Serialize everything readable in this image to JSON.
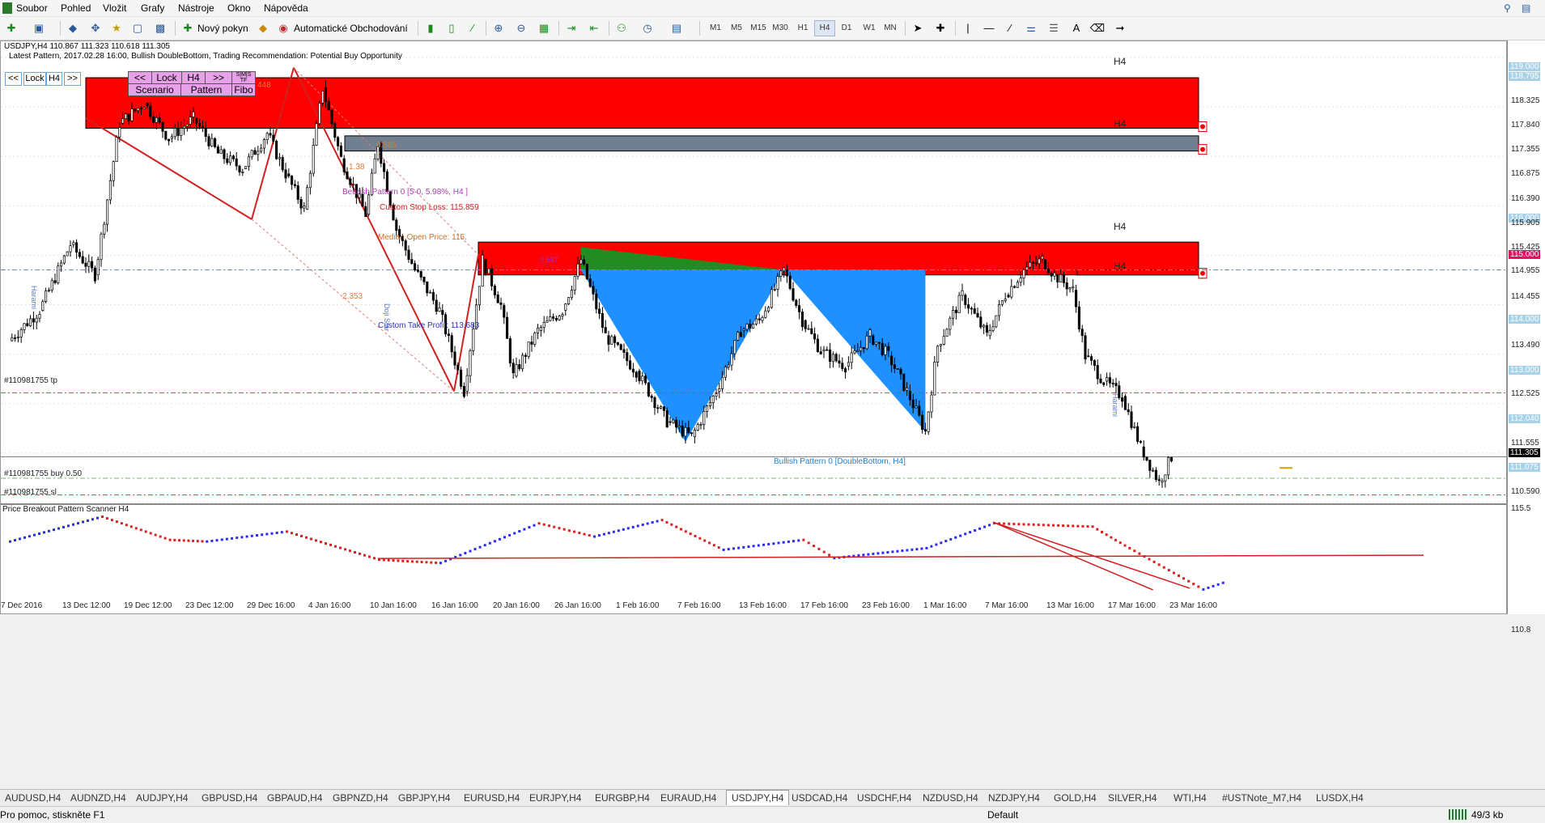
{
  "menu": [
    "Soubor",
    "Pohled",
    "Vložit",
    "Grafy",
    "Nástroje",
    "Okno",
    "Nápověda"
  ],
  "toolbar": {
    "new_order": "Nový pokyn",
    "algo_trading": "Automatické Obchodování",
    "timeframes": [
      "M1",
      "M5",
      "M15",
      "M30",
      "H1",
      "H4",
      "D1",
      "W1",
      "MN"
    ],
    "active_timeframe": "H4"
  },
  "chart": {
    "header": "USDJPY,H4  110.867 111.323 110.618 111.305",
    "subheader": "Latest Pattern, 2017.02.28 16:00, Bullish DoubleBottom, Trading Recommendation: Potential Buy Opportunity",
    "lock_widget": {
      "prev": "<<",
      "lock": "Lock",
      "tf": "H4",
      "next": ">>"
    },
    "panel": {
      "prev": "<<",
      "lock": "Lock",
      "tf": "H4",
      "next": ">>",
      "scenario": "Scenario",
      "pattern": "Pattern",
      "fibo": "Fibo",
      "smt": "S|M|S TF"
    },
    "zone_labels": [
      "H4",
      "H4",
      "H4",
      "H4"
    ],
    "fib_labels": [
      "0.585",
      "1.38",
      "2.353",
      "448"
    ],
    "bearish_pattern": "Bearish Pattern 0  [5-0,  5.98%, H4 ]",
    "custom_stop_loss": "Custom Stop Loss: 115.859",
    "median_open": "Median Open Price: 115.",
    "custom_take_profit": "Custom Take Profit: 113.683",
    "bullish_pattern": "Bullish Pattern 0  [DoubleBottom, H4]",
    "small_label": "0.597",
    "vertical_labels": {
      "harami_left": "Harami",
      "doji": "Doji Star",
      "harami_right": "Harami"
    },
    "orders": {
      "tp": "#110981755 tp",
      "buy": "#110981755 buy 0.50",
      "sl": "#110981755 sl"
    }
  },
  "price_axis": {
    "labels": [
      "119.000",
      "118.795",
      "118.325",
      "117.840",
      "117.355",
      "116.875",
      "116.390",
      "116.000",
      "115.905",
      "115.425",
      "115.000",
      "114.955",
      "114.455",
      "114.000",
      "113.490",
      "113.000",
      "112.525",
      "112.040",
      "111.555",
      "111.305",
      "111.075",
      "110.590"
    ],
    "current": "111.305",
    "level_115": "115.000"
  },
  "sub_window": {
    "title": "Price Breakout Pattern Scanner H4",
    "top_label": "115.5",
    "bottom_label": "110.8"
  },
  "time_axis": [
    "7 Dec 2016",
    "13 Dec 12:00",
    "19 Dec 12:00",
    "23 Dec 12:00",
    "29 Dec 16:00",
    "4 Jan 16:00",
    "10 Jan 16:00",
    "16 Jan 16:00",
    "20 Jan 16:00",
    "26 Jan 16:00",
    "1 Feb 16:00",
    "7 Feb 16:00",
    "13 Feb 16:00",
    "17 Feb 16:00",
    "23 Feb 16:00",
    "1 Mar 16:00",
    "7 Mar 16:00",
    "13 Mar 16:00",
    "17 Mar 16:00",
    "23 Mar 16:00"
  ],
  "tabs": [
    "AUDUSD,H4",
    "AUDNZD,H4",
    "AUDJPY,H4",
    "GBPUSD,H4",
    "GBPAUD,H4",
    "GBPNZD,H4",
    "GBPJPY,H4",
    "EURUSD,H4",
    "EURJPY,H4",
    "EURGBP,H4",
    "EURAUD,H4",
    "USDJPY,H4",
    "USDCAD,H4",
    "USDCHF,H4",
    "NZDUSD,H4",
    "NZDJPY,H4",
    "GOLD,H4",
    "SILVER,H4",
    "WTI,H4",
    "#USTNote_M7,H4",
    "LUSDX,H4"
  ],
  "active_tab": "USDJPY,H4",
  "status": {
    "help": "Pro pomoc, stiskněte F1",
    "profile": "Default",
    "traffic": "49/3 kb"
  },
  "chart_data": {
    "type": "candlestick",
    "symbol": "USDJPY",
    "timeframe": "H4",
    "ylim": [
      110.4,
      119.2
    ],
    "x": [
      "7 Dec 2016",
      "13 Dec 12:00",
      "19 Dec 12:00",
      "23 Dec 12:00",
      "29 Dec 16:00",
      "4 Jan 16:00",
      "10 Jan 16:00",
      "16 Jan 16:00",
      "20 Jan 16:00",
      "26 Jan 16:00",
      "1 Feb 16:00",
      "7 Feb 16:00",
      "13 Feb 16:00",
      "17 Feb 16:00",
      "23 Feb 16:00",
      "1 Mar 16:00",
      "7 Mar 16:00",
      "13 Mar 16:00",
      "17 Mar 16:00",
      "23 Mar 16:00"
    ],
    "close_path": [
      [
        0,
        113.6
      ],
      [
        0.5,
        114.2
      ],
      [
        1,
        115.5
      ],
      [
        1.4,
        114.9
      ],
      [
        1.8,
        117.9
      ],
      [
        2.2,
        118.3
      ],
      [
        2.6,
        117.6
      ],
      [
        3.0,
        118.0
      ],
      [
        3.4,
        117.3
      ],
      [
        3.8,
        117.0
      ],
      [
        4.2,
        117.7
      ],
      [
        4.5,
        116.9
      ],
      [
        4.8,
        116.2
      ],
      [
        5.1,
        118.6
      ],
      [
        5.4,
        117.2
      ],
      [
        5.8,
        116.1
      ],
      [
        6.0,
        117.5
      ],
      [
        6.3,
        115.8
      ],
      [
        6.6,
        115.0
      ],
      [
        7.0,
        114.2
      ],
      [
        7.4,
        112.6
      ],
      [
        7.7,
        115.2
      ],
      [
        8.0,
        114.3
      ],
      [
        8.2,
        112.9
      ],
      [
        8.6,
        113.8
      ],
      [
        9.0,
        114.2
      ],
      [
        9.3,
        115.2
      ],
      [
        9.7,
        113.7
      ],
      [
        10.2,
        113.0
      ],
      [
        10.7,
        112.0
      ],
      [
        11.1,
        111.7
      ],
      [
        11.5,
        112.6
      ],
      [
        11.9,
        113.8
      ],
      [
        12.2,
        114.0
      ],
      [
        12.6,
        115.0
      ],
      [
        12.9,
        114.0
      ],
      [
        13.2,
        113.4
      ],
      [
        13.6,
        113.1
      ],
      [
        14.0,
        113.7
      ],
      [
        14.3,
        113.3
      ],
      [
        14.6,
        112.6
      ],
      [
        14.9,
        111.8
      ],
      [
        15.1,
        113.5
      ],
      [
        15.5,
        114.5
      ],
      [
        15.9,
        113.7
      ],
      [
        16.2,
        114.5
      ],
      [
        16.5,
        115.0
      ],
      [
        16.8,
        115.2
      ],
      [
        17.0,
        114.9
      ],
      [
        17.3,
        114.6
      ],
      [
        17.5,
        113.3
      ],
      [
        17.8,
        112.8
      ],
      [
        18.1,
        112.5
      ],
      [
        18.4,
        111.5
      ],
      [
        18.7,
        110.8
      ],
      [
        18.9,
        111.3
      ]
    ],
    "zones": [
      {
        "from": 118.8,
        "to": 117.8,
        "color": "#ff0000",
        "label": "H4"
      },
      {
        "from": 117.65,
        "to": 117.35,
        "color": "#708090",
        "label": "H4"
      },
      {
        "from": 115.55,
        "to": 114.9,
        "color": "#ff0000",
        "label": "H4"
      },
      {
        "from": 115.0,
        "to": 114.9,
        "color": "#ff0000",
        "label": "H4"
      }
    ],
    "levels": [
      {
        "name": "#110981755 tp",
        "value": 112.57
      },
      {
        "name": "#110981755 buy 0.50",
        "value": 110.88
      },
      {
        "name": "#110981755 sl",
        "value": 110.55
      },
      {
        "name": "115.000",
        "value": 115.0
      }
    ],
    "sub_ylim": [
      110.8,
      115.5
    ]
  },
  "colors": {
    "bull": "#2a2aff",
    "bear": "#e02020",
    "zone_red": "#ff0000",
    "zone_grey": "#708090",
    "pattern_blue": "#1e90ff",
    "pattern_green": "#228b22",
    "current_price": "#000000",
    "level_115": "#e0115f"
  }
}
